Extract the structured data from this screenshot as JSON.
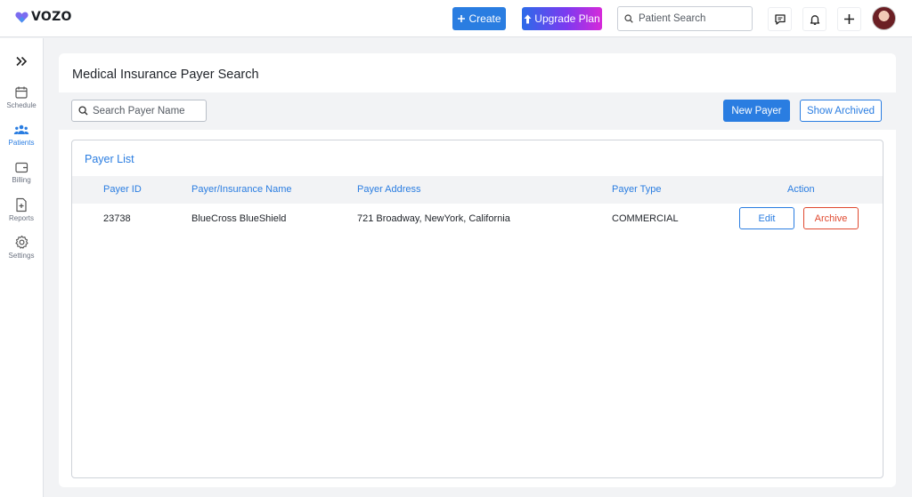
{
  "app": {
    "brand": "VOZO",
    "brand_color": "#7b6cf0"
  },
  "header": {
    "create_label": "Create",
    "upgrade_label": "Upgrade Plan",
    "patient_search_placeholder": "Patient Search",
    "icons": [
      "message-icon",
      "bell-icon",
      "plus-icon"
    ]
  },
  "sidebar": {
    "items": [
      {
        "label": "Schedule",
        "icon": "calendar-icon",
        "active": false
      },
      {
        "label": "Patients",
        "icon": "users-icon",
        "active": true
      },
      {
        "label": "Billing",
        "icon": "wallet-icon",
        "active": false
      },
      {
        "label": "Reports",
        "icon": "report-icon",
        "active": false
      },
      {
        "label": "Settings",
        "icon": "gear-icon",
        "active": false
      }
    ]
  },
  "page": {
    "title": "Medical Insurance Payer Search",
    "search_placeholder": "Search Payer Name",
    "new_payer_label": "New Payer",
    "show_archived_label": "Show Archived"
  },
  "payer_list": {
    "title": "Payer List",
    "columns": [
      "Payer ID",
      "Payer/Insurance Name",
      "Payer Address",
      "Payer Type",
      "Action"
    ],
    "rows": [
      {
        "id": "23738",
        "name": "BlueCross BlueShield",
        "address": "721 Broadway, NewYork, California",
        "type": "COMMERCIAL",
        "edit_label": "Edit",
        "archive_label": "Archive"
      }
    ]
  },
  "colors": {
    "primary": "#2a7de1",
    "danger": "#e0492f"
  }
}
